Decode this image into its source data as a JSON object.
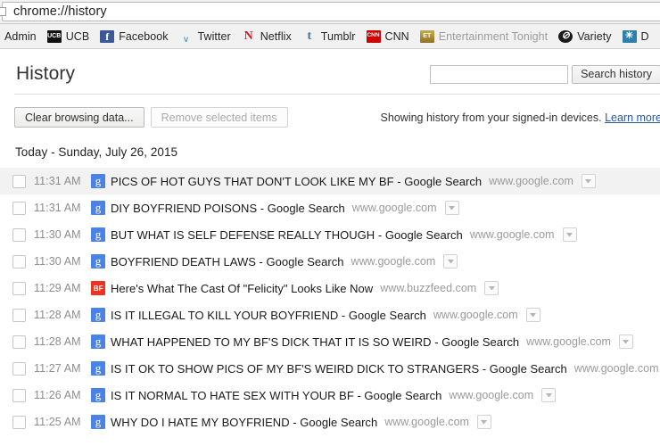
{
  "omnibox": {
    "url": "chrome://history",
    "page_icon": "document-icon"
  },
  "bookmarks": [
    {
      "label": "Admin",
      "icon": "none",
      "faded": false
    },
    {
      "label": "UCB",
      "icon": "ucb-icon",
      "glyph": "UCB",
      "faded": false
    },
    {
      "label": "Facebook",
      "icon": "facebook-icon",
      "glyph": "f",
      "faded": false
    },
    {
      "label": "Twitter",
      "icon": "twitter-icon",
      "glyph": "ᵥ",
      "faded": false
    },
    {
      "label": "Netflix",
      "icon": "netflix-icon",
      "glyph": "N",
      "faded": false
    },
    {
      "label": "Tumblr",
      "icon": "tumblr-icon",
      "glyph": "t",
      "faded": false
    },
    {
      "label": "CNN",
      "icon": "cnn-icon",
      "glyph": "CNN",
      "faded": false
    },
    {
      "label": "Entertainment Tonight",
      "icon": "et-icon",
      "glyph": "ET",
      "faded": true
    },
    {
      "label": "Variety",
      "icon": "variety-icon",
      "glyph": "⊘",
      "faded": false
    },
    {
      "label": "D",
      "icon": "deadline-icon",
      "glyph": "✳",
      "faded": false
    }
  ],
  "header": {
    "title": "History",
    "search_value": "",
    "search_placeholder": "",
    "search_button": "Search history"
  },
  "toolbar": {
    "clear_button": "Clear browsing data...",
    "remove_button": "Remove selected items",
    "remove_disabled": true,
    "notice": "Showing history from your signed-in devices.",
    "learn_more": "Learn more"
  },
  "day_heading": "Today - Sunday, July 26, 2015",
  "entries": [
    {
      "time": "11:31 AM",
      "favicon": "google-icon",
      "glyph": "g",
      "title": "PICS OF HOT GUYS THAT DON'T LOOK LIKE MY BF - Google Search",
      "url": "www.google.com",
      "hovered": true
    },
    {
      "time": "11:31 AM",
      "favicon": "google-icon",
      "glyph": "g",
      "title": "DIY BOYFRIEND POISONS - Google Search",
      "url": "www.google.com",
      "hovered": false
    },
    {
      "time": "11:30 AM",
      "favicon": "google-icon",
      "glyph": "g",
      "title": "BUT WHAT IS SELF DEFENSE REALLY THOUGH - Google Search",
      "url": "www.google.com",
      "hovered": false
    },
    {
      "time": "11:30 AM",
      "favicon": "google-icon",
      "glyph": "g",
      "title": "BOYFRIEND DEATH LAWS - Google Search",
      "url": "www.google.com",
      "hovered": false
    },
    {
      "time": "11:29 AM",
      "favicon": "buzzfeed-icon",
      "glyph": "BF",
      "title": "Here's What The Cast Of \"Felicity\" Looks Like Now",
      "url": "www.buzzfeed.com",
      "hovered": false
    },
    {
      "time": "11:28 AM",
      "favicon": "google-icon",
      "glyph": "g",
      "title": "IS IT ILLEGAL TO KILL YOUR BOYFRIEND - Google Search",
      "url": "www.google.com",
      "hovered": false
    },
    {
      "time": "11:28 AM",
      "favicon": "google-icon",
      "glyph": "g",
      "title": "WHAT HAPPENED TO MY BF'S DICK THAT IT IS SO WEIRD - Google Search",
      "url": "www.google.com",
      "hovered": false
    },
    {
      "time": "11:27 AM",
      "favicon": "google-icon",
      "glyph": "g",
      "title": "IS IT OK TO SHOW PICS OF MY BF'S WEIRD DICK TO STRANGERS - Google Search",
      "url": "www.google.com",
      "hovered": false
    },
    {
      "time": "11:26 AM",
      "favicon": "google-icon",
      "glyph": "g",
      "title": "IS IT NORMAL TO HATE SEX WITH YOUR BF - Google Search",
      "url": "www.google.com",
      "hovered": false
    },
    {
      "time": "11:25 AM",
      "favicon": "google-icon",
      "glyph": "g",
      "title": "WHY DO I HATE MY BOYFRIEND - Google Search",
      "url": "www.google.com",
      "hovered": false
    }
  ],
  "colors": {
    "google_blue": "#4a82e8",
    "buzzfeed_red": "#ee3322",
    "link_blue": "#2a55a3",
    "chrome_chrome": "#f1f1f1"
  }
}
